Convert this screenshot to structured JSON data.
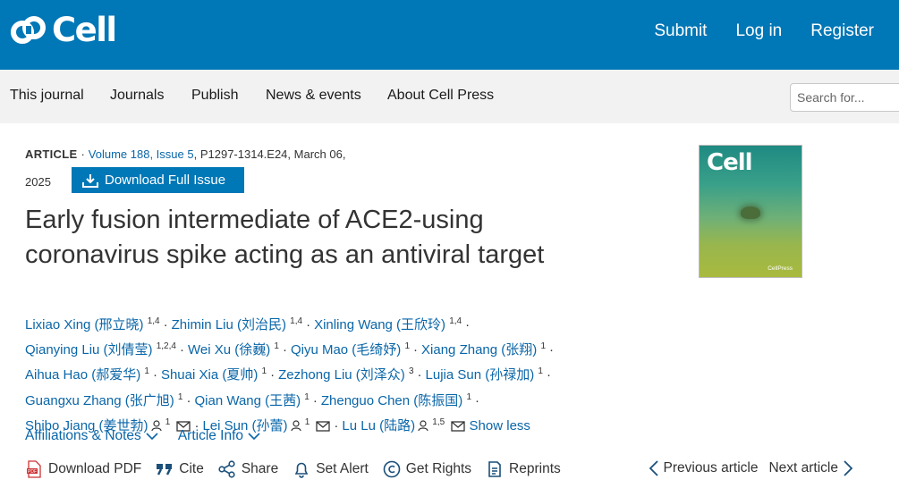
{
  "header": {
    "logo_text": "Cell",
    "links": [
      "Submit",
      "Log in",
      "Register"
    ]
  },
  "nav": {
    "items": [
      "This journal",
      "Journals",
      "Publish",
      "News & events",
      "About Cell Press"
    ],
    "search_placeholder": "Search for..."
  },
  "article": {
    "type": "ARTICLE",
    "volume_issue": "Volume 188, Issue 5",
    "pages_date": "P1297-1314.E24, March 06,",
    "year": "2025",
    "download_label": "Download Full Issue",
    "title": "Early fusion intermediate of ACE2-using coronavirus spike acting as an antiviral target"
  },
  "authors": [
    {
      "name": "Lixiao Xing (邢立晓)",
      "sup": "1,4"
    },
    {
      "name": "Zhimin Liu (刘治民)",
      "sup": "1,4"
    },
    {
      "name": "Xinling Wang (王欣玲)",
      "sup": "1,4"
    },
    {
      "name": "Qianying Liu (刘倩莹)",
      "sup": "1,2,4"
    },
    {
      "name": "Wei Xu (徐巍)",
      "sup": "1"
    },
    {
      "name": "Qiyu Mao (毛绮妤)",
      "sup": "1"
    },
    {
      "name": "Xiang Zhang (张翔)",
      "sup": "1"
    },
    {
      "name": "Aihua Hao (郝爱华)",
      "sup": "1"
    },
    {
      "name": "Shuai Xia (夏帅)",
      "sup": "1"
    },
    {
      "name": "Zezhong Liu (刘泽众)",
      "sup": "3"
    },
    {
      "name": "Lujia Sun (孙禄加)",
      "sup": "1"
    },
    {
      "name": "Guangxu Zhang (张广旭)",
      "sup": "1"
    },
    {
      "name": "Qian Wang (王茜)",
      "sup": "1"
    },
    {
      "name": "Zhenguo Chen (陈振国)",
      "sup": "1"
    },
    {
      "name": "Shibo Jiang (姜世勃)",
      "sup": "1"
    },
    {
      "name": "Lei Sun (孙蕾)",
      "sup": "1"
    },
    {
      "name": "Lu Lu (陆路)",
      "sup": "1,5"
    }
  ],
  "show_less": "Show less",
  "sub_links": [
    "Affiliations & Notes",
    "Article Info"
  ],
  "tools": [
    "Download PDF",
    "Cite",
    "Share",
    "Set Alert",
    "Get Rights",
    "Reprints"
  ],
  "pager": {
    "prev": "Previous article",
    "next": "Next article"
  },
  "cover": {
    "title": "Cell",
    "publisher": "CellPress"
  },
  "colors": {
    "brand": "#0077b6",
    "link": "#0a66a8",
    "nav_bg": "#f2f2f2"
  }
}
